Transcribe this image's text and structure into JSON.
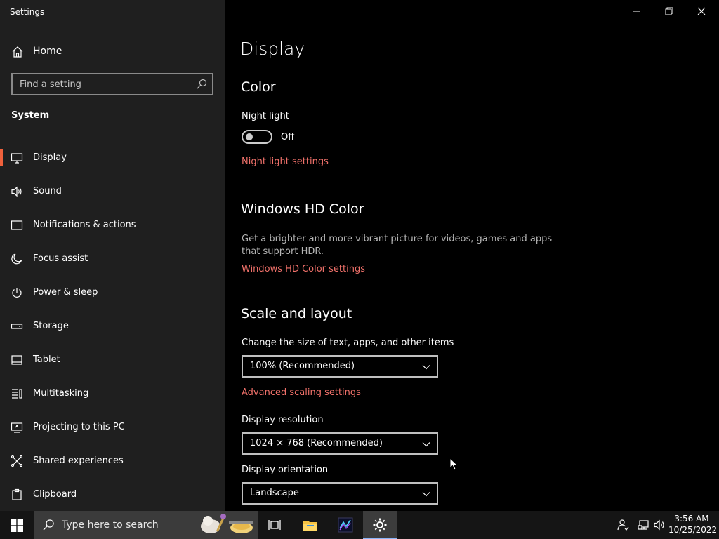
{
  "window": {
    "title": "Settings"
  },
  "sidebar": {
    "home_label": "Home",
    "search_placeholder": "Find a setting",
    "section": "System",
    "items": [
      {
        "label": "Display",
        "icon": "monitor-icon",
        "active": true
      },
      {
        "label": "Sound",
        "icon": "speaker-icon"
      },
      {
        "label": "Notifications & actions",
        "icon": "notification-icon"
      },
      {
        "label": "Focus assist",
        "icon": "moon-icon"
      },
      {
        "label": "Power & sleep",
        "icon": "power-icon"
      },
      {
        "label": "Storage",
        "icon": "storage-icon"
      },
      {
        "label": "Tablet",
        "icon": "tablet-icon"
      },
      {
        "label": "Multitasking",
        "icon": "multitasking-icon"
      },
      {
        "label": "Projecting to this PC",
        "icon": "projecting-icon"
      },
      {
        "label": "Shared experiences",
        "icon": "shared-experiences-icon"
      },
      {
        "label": "Clipboard",
        "icon": "clipboard-icon"
      }
    ]
  },
  "main": {
    "title": "Display",
    "color": {
      "heading": "Color",
      "night_light_label": "Night light",
      "night_light_state": "Off",
      "night_light_on": false,
      "night_light_link": "Night light settings"
    },
    "hd_color": {
      "heading": "Windows HD Color",
      "description": "Get a brighter and more vibrant picture for videos, games and apps that support HDR.",
      "link": "Windows HD Color settings"
    },
    "scale": {
      "heading": "Scale and layout",
      "size_label": "Change the size of text, apps, and other items",
      "size_value": "100% (Recommended)",
      "advanced_link": "Advanced scaling settings",
      "resolution_label": "Display resolution",
      "resolution_value": "1024 × 768 (Recommended)",
      "orientation_label": "Display orientation",
      "orientation_value": "Landscape"
    }
  },
  "taskbar": {
    "search_text": "Type here to search",
    "time": "3:56 AM",
    "date": "10/25/2022"
  },
  "colors": {
    "accent": "#f0613c",
    "link": "#f0716a",
    "sidebar_bg": "#1f1f1f",
    "main_bg": "#000000"
  }
}
